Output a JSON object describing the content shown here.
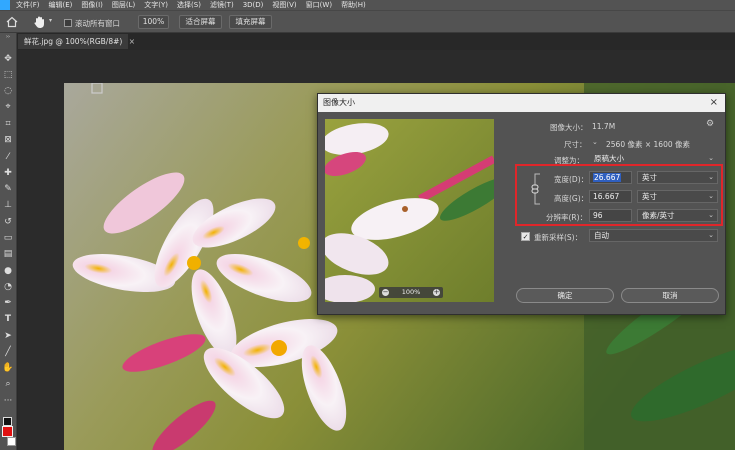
{
  "menubar": {
    "items": [
      "文件(F)",
      "编辑(E)",
      "图像(I)",
      "图层(L)",
      "文字(Y)",
      "选择(S)",
      "滤镜(T)",
      "3D(D)",
      "视图(V)",
      "窗口(W)",
      "帮助(H)"
    ]
  },
  "options": {
    "scroll_all_label": "滚动所有窗口",
    "zoom_value": "100%",
    "fit_screen_label": "适合屏幕",
    "fill_screen_label": "填充屏幕"
  },
  "document": {
    "tab_title": "鲜花.jpg @ 100%(RGB/8#)",
    "close_symbol": "×"
  },
  "dialog": {
    "title": "图像大小",
    "close_symbol": "×",
    "image_size_label": "图像大小：",
    "image_size_value": "11.7M",
    "dimensions_label": "尺寸：",
    "dimensions_value": "2560 像素 × 1600 像素",
    "fit_to_label": "调整为：",
    "fit_to_value": "原稿大小",
    "width_label": "宽度(D)：",
    "width_value": "26.667",
    "width_unit": "英寸",
    "height_label": "高度(G)：",
    "height_value": "16.667",
    "height_unit": "英寸",
    "resolution_label": "分辨率(R)：",
    "resolution_value": "96",
    "resolution_unit": "像素/英寸",
    "resample_label": "重新采样(S)：",
    "resample_value": "自动",
    "preview_zoom": "100%",
    "ok_label": "确定",
    "cancel_label": "取消"
  },
  "colors": {
    "accent": "#31a8ff",
    "highlight_box": "#e0262a",
    "foreground_swatch": "#e01010"
  }
}
